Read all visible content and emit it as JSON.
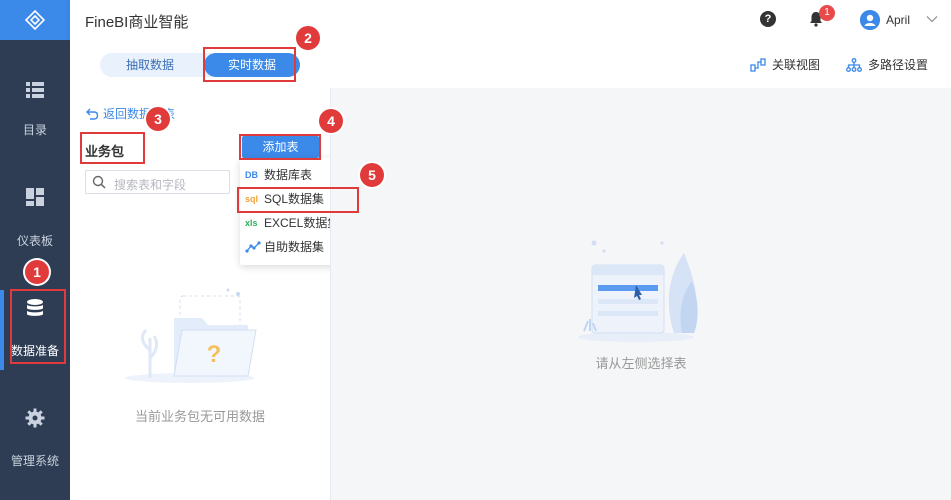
{
  "header": {
    "app_title": "FineBI商业智能",
    "help_glyph": "?",
    "notification_count": "1",
    "user_name": "April"
  },
  "sidebar": {
    "items": [
      {
        "label": "目录",
        "icon": "list-icon"
      },
      {
        "label": "仪表板",
        "icon": "dashboard-icon"
      },
      {
        "label": "数据准备",
        "icon": "database-icon",
        "active": true
      },
      {
        "label": "管理系统",
        "icon": "gear-icon"
      }
    ]
  },
  "toolbar": {
    "tabs": [
      {
        "label": "抽取数据"
      },
      {
        "label": "实时数据",
        "active": true
      }
    ],
    "relation_view": "关联视图",
    "multi_path": "多路径设置"
  },
  "left_panel": {
    "back_label": "返回数据列表",
    "package_title": "业务包",
    "search_placeholder": "搜索表和字段",
    "empty_text": "当前业务包无可用数据",
    "add_table_label": "添加表",
    "add_menu": [
      {
        "label": "数据库表",
        "icon_text": "DB"
      },
      {
        "label": "SQL数据集",
        "icon_text": "sql"
      },
      {
        "label": "EXCEL数据集",
        "icon_text": "xls"
      },
      {
        "label": "自助数据集",
        "icon_text": ""
      }
    ]
  },
  "right_area": {
    "placeholder_text": "请从左侧选择表"
  },
  "annotations": [
    "1",
    "2",
    "3",
    "4",
    "5"
  ],
  "colors": {
    "sidebar_bg": "#2e3d54",
    "accent": "#3b89e8",
    "annotation_red": "#e03a3a"
  }
}
